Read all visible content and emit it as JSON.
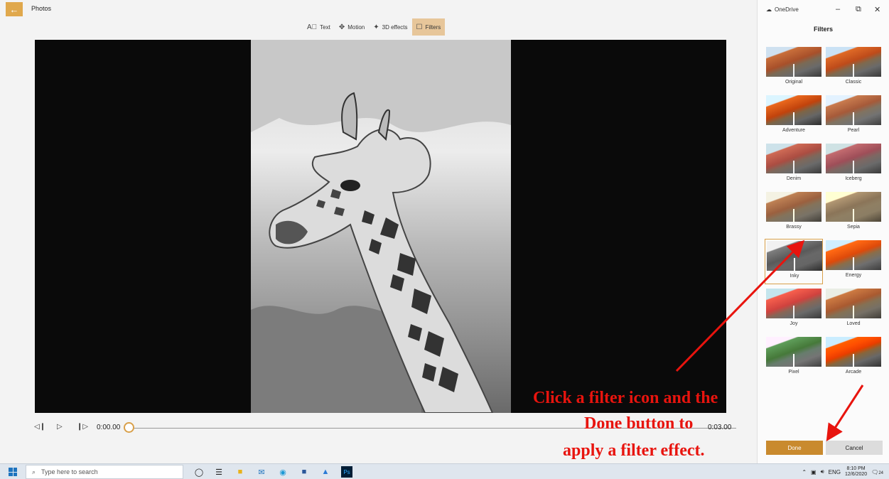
{
  "app": {
    "title": "Photos",
    "back_icon": "←"
  },
  "toolbar": {
    "tools": [
      {
        "label": "Text",
        "icon": "text-icon"
      },
      {
        "label": "Motion",
        "icon": "motion-icon"
      },
      {
        "label": "3D effects",
        "icon": "3d-effects-icon"
      },
      {
        "label": "Filters",
        "icon": "filters-icon",
        "active": true
      }
    ]
  },
  "playback": {
    "current_time": "0:00.00",
    "end_time": "0:03.00",
    "progress": 0
  },
  "panel": {
    "cloud_label": "OneDrive",
    "title": "Filters",
    "filters": [
      {
        "label": "Original"
      },
      {
        "label": "Classic"
      },
      {
        "label": "Adventure"
      },
      {
        "label": "Pearl"
      },
      {
        "label": "Denim"
      },
      {
        "label": "Iceberg"
      },
      {
        "label": "Brassy"
      },
      {
        "label": "Sepia"
      },
      {
        "label": "Inky",
        "selected": true
      },
      {
        "label": "Energy"
      },
      {
        "label": "Joy"
      },
      {
        "label": "Loved"
      },
      {
        "label": "Pixel"
      },
      {
        "label": "Arcade"
      }
    ],
    "done_label": "Done",
    "cancel_label": "Cancel"
  },
  "annotation": {
    "line1": "Click a filter icon and the",
    "line2": "Done button to",
    "line3": "apply a filter effect."
  },
  "taskbar": {
    "search_placeholder": "Type here to search",
    "language": "ENG",
    "time": "8:10 PM",
    "date": "12/6/2020",
    "notification_count": "24"
  },
  "colors": {
    "accent": "#c98a2e",
    "annotation": "#e8140e",
    "selected_tool": "#e7c69a"
  }
}
